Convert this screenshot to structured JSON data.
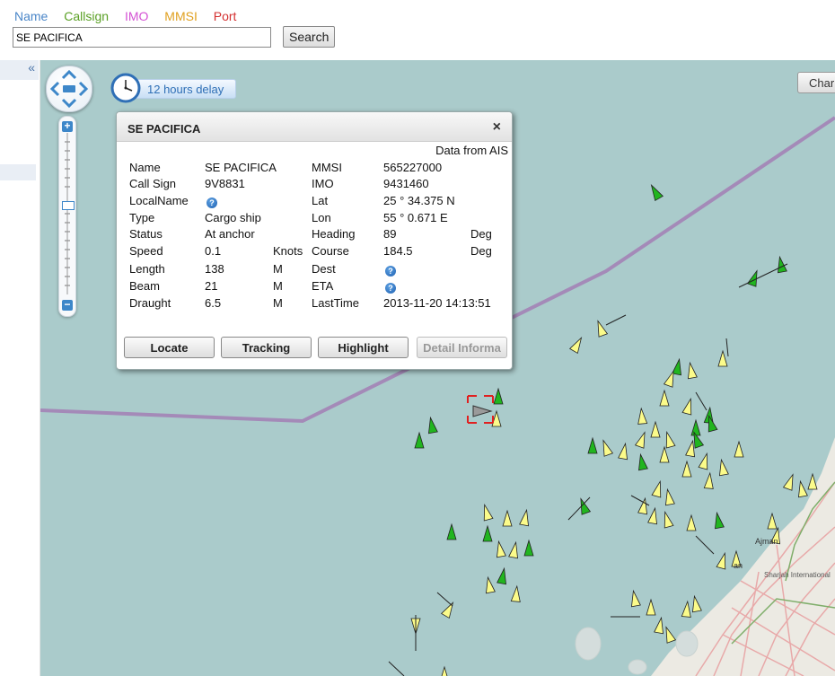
{
  "search": {
    "tabs": [
      {
        "label": "Name",
        "color": "#4a86c8"
      },
      {
        "label": "Callsign",
        "color": "#5aa025"
      },
      {
        "label": "IMO",
        "color": "#d452d4"
      },
      {
        "label": "MMSI",
        "color": "#e0a020"
      },
      {
        "label": "Port",
        "color": "#d43030"
      }
    ],
    "value": "SE PACIFICA",
    "button_label": "Search"
  },
  "sidebar": {
    "collapse_label": "«"
  },
  "map": {
    "delay_label": "12 hours delay",
    "chart_button_label": "Char",
    "labels": {
      "ajman": "Ajman",
      "sharjah": "Sharjah International",
      "an": "an"
    }
  },
  "popup": {
    "title": "SE PACIFICA",
    "close": "×",
    "source": "Data from AIS",
    "fields": {
      "name_label": "Name",
      "name": "SE PACIFICA",
      "callsign_label": "Call Sign",
      "callsign": "9V8831",
      "localname_label": "LocalName",
      "type_label": "Type",
      "type": "Cargo ship",
      "status_label": "Status",
      "status": "At anchor",
      "speed_label": "Speed",
      "speed": "0.1",
      "speed_unit": "Knots",
      "length_label": "Length",
      "length": "138",
      "length_unit": "M",
      "beam_label": "Beam",
      "beam": "21",
      "beam_unit": "M",
      "draught_label": "Draught",
      "draught": "6.5",
      "draught_unit": "M",
      "mmsi_label": "MMSI",
      "mmsi": "565227000",
      "imo_label": "IMO",
      "imo": "9431460",
      "lat_label": "Lat",
      "lat": "25 ° 34.375 N",
      "lon_label": "Lon",
      "lon": "55 ° 0.671 E",
      "heading_label": "Heading",
      "heading": "89",
      "heading_unit": "Deg",
      "course_label": "Course",
      "course": "184.5",
      "course_unit": "Deg",
      "dest_label": "Dest",
      "eta_label": "ETA",
      "lasttime_label": "LastTime",
      "lasttime": "2013-11-20 14:13:51",
      "help_glyph": "?"
    },
    "buttons": {
      "locate": "Locate",
      "tracking": "Tracking",
      "highlight": "Highlight",
      "detail": "Detail Informa"
    }
  },
  "colors": {
    "sea": "#aacbcb",
    "land": "#eceae3",
    "boundary": "#a48ab8",
    "ship_yellow": "#fbfb8a",
    "ship_green": "#21b51f"
  }
}
